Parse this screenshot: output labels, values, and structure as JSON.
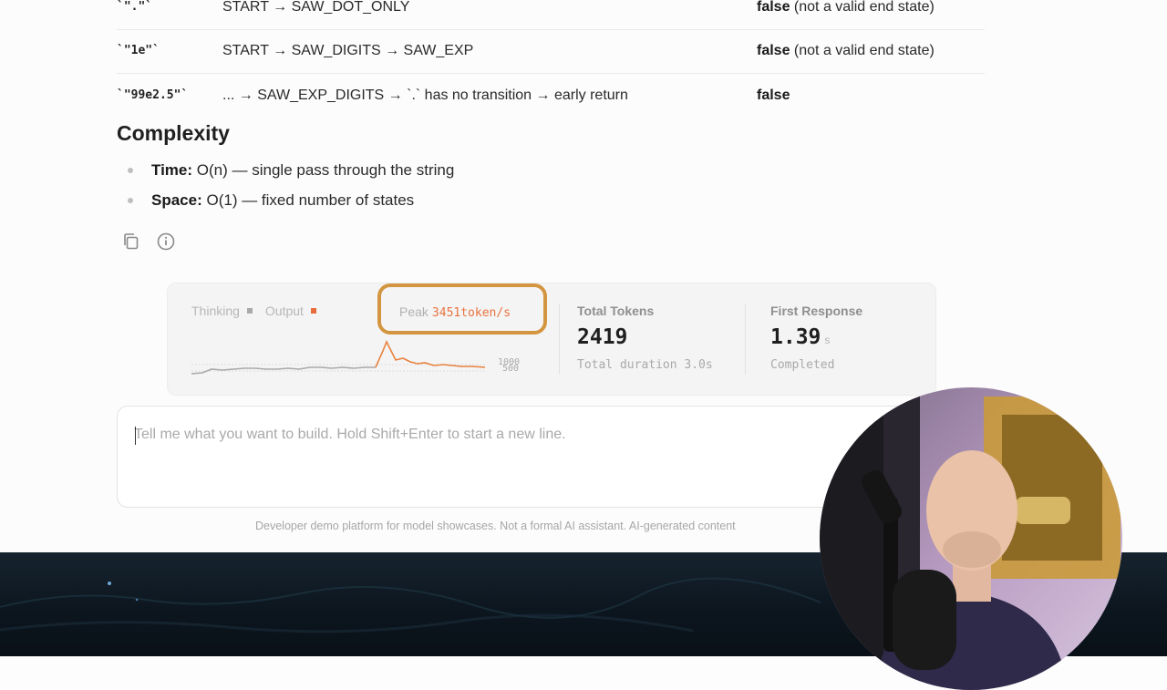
{
  "table_rows": [
    {
      "input": "`\".\"`",
      "trace": "START → SAW_DOT_ONLY",
      "result": "false",
      "result_note": "(not a valid end state)"
    },
    {
      "input": "`\"1e\"`",
      "trace": "START → SAW_DIGITS → SAW_EXP",
      "result": "false",
      "result_note": "(not a valid end state)"
    },
    {
      "input": "`\"99e2.5\"`",
      "trace": "... → SAW_EXP_DIGITS → `.` has no transition → early return",
      "result": "false",
      "result_note": ""
    }
  ],
  "complexity": {
    "heading": "Complexity",
    "items": [
      {
        "label": "Time:",
        "text": "O(n) — single pass through the string"
      },
      {
        "label": "Space:",
        "text": "O(1) — fixed number of states"
      }
    ]
  },
  "actions": {
    "copy_icon": "copy-icon",
    "info_icon": "info-icon"
  },
  "stats": {
    "legend": {
      "thinking": "Thinking",
      "output": "Output"
    },
    "peak_label": "Peak",
    "peak_value": "3451token/s",
    "axis_ticks": [
      "1000",
      "500"
    ],
    "total_tokens": {
      "title": "Total Tokens",
      "value": "2419",
      "sub": "Total duration 3.0s"
    },
    "first_response": {
      "title": "First Response",
      "value": "1.39",
      "unit": "s",
      "sub": "Completed"
    },
    "colors": {
      "thinking": "#a9a9a9",
      "output": "#e86b3a",
      "highlight": "#d39540"
    }
  },
  "composer": {
    "placeholder": "Tell me what you want to build. Hold Shift+Enter to start a new line.",
    "value": ""
  },
  "disclaimer": "Developer demo platform for model showcases. Not a formal AI assistant. AI-generated content"
}
